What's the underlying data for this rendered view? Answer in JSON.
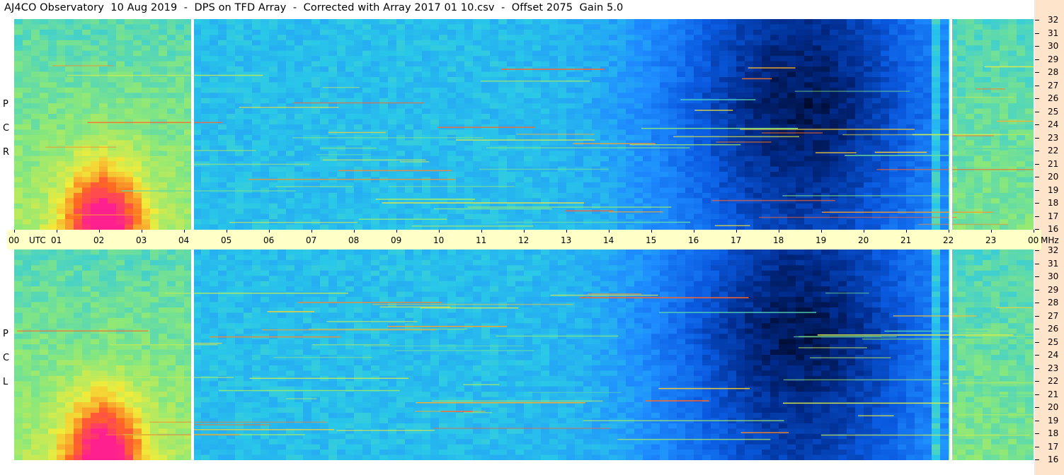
{
  "title": "AJ4CO Observatory  10 Aug 2019  -  DPS on TFD Array  -  Corrected with Array 2017 01 10.csv  -  Offset 2075  Gain 5.0",
  "chart_data": {
    "type": "heatmap",
    "title": "AJ4CO Observatory  10 Aug 2019  -  DPS on TFD Array  -  Corrected with Array 2017 01 10.csv  -  Offset 2075  Gain 5.0",
    "x_axis": {
      "label": "UTC",
      "tick_labels": [
        "00",
        "UTC",
        "01",
        "02",
        "03",
        "04",
        "05",
        "06",
        "07",
        "08",
        "09",
        "10",
        "11",
        "12",
        "13",
        "14",
        "15",
        "16",
        "17",
        "18",
        "19",
        "20",
        "21",
        "22",
        "23",
        "00"
      ],
      "range": [
        0,
        24
      ]
    },
    "y_axis": {
      "label": "MHz",
      "tick_labels": [
        "32",
        "31",
        "30",
        "29",
        "28",
        "27",
        "26",
        "25",
        "24",
        "23",
        "22",
        "21",
        "20",
        "19",
        "18",
        "17",
        "16"
      ],
      "range": [
        16,
        32
      ]
    },
    "panels": [
      {
        "name": "R C P",
        "letters": [
          "R",
          "C",
          "P"
        ]
      },
      {
        "name": "L C P",
        "letters": [
          "L",
          "C",
          "P"
        ]
      }
    ],
    "data_gaps_utc": [
      4.2,
      22.05
    ],
    "colormap": [
      "#000010",
      "#002a8a",
      "#0a5ae0",
      "#1e8cff",
      "#2ac8e8",
      "#8ae87a",
      "#f2ec3a",
      "#ff6a20",
      "#ff2090"
    ]
  }
}
